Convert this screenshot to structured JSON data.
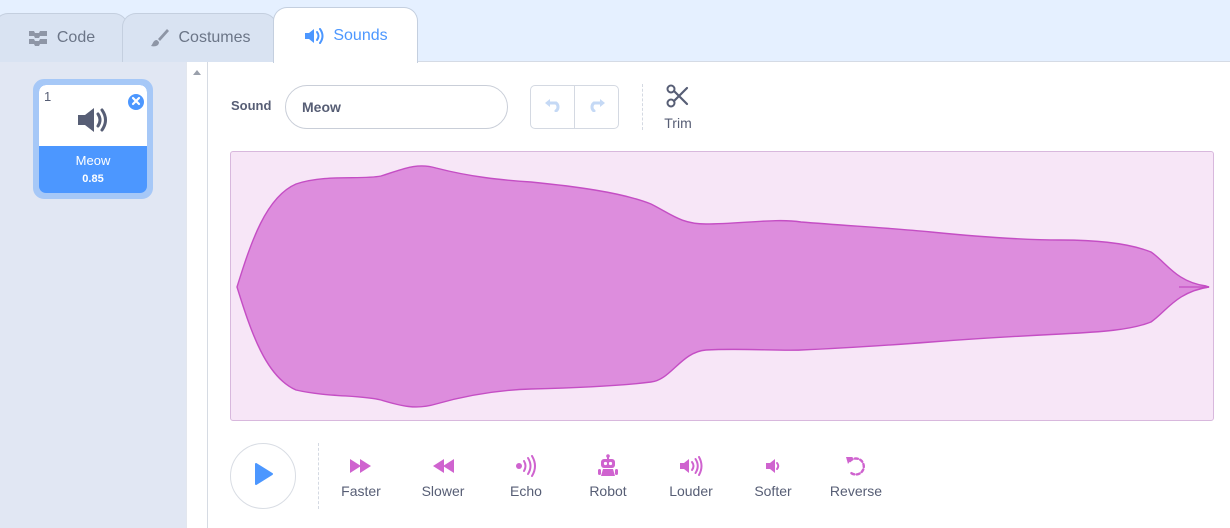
{
  "tabs": [
    {
      "label": "Code",
      "icon": "code-blocks-icon"
    },
    {
      "label": "Costumes",
      "icon": "paintbrush-icon"
    },
    {
      "label": "Sounds",
      "icon": "speaker-icon",
      "active": true
    }
  ],
  "sound_list": [
    {
      "number": "1",
      "name": "Meow",
      "duration": "0.85",
      "selected": true
    }
  ],
  "editor": {
    "sound_label": "Sound",
    "sound_name": "Meow",
    "undo_icon": "undo-icon",
    "redo_icon": "redo-icon",
    "trim_label": "Trim",
    "play_icon": "play-icon",
    "effects": [
      {
        "label": "Faster",
        "icon": "fast-forward-icon"
      },
      {
        "label": "Slower",
        "icon": "rewind-icon"
      },
      {
        "label": "Echo",
        "icon": "echo-icon"
      },
      {
        "label": "Robot",
        "icon": "robot-icon"
      },
      {
        "label": "Louder",
        "icon": "louder-icon"
      },
      {
        "label": "Softer",
        "icon": "softer-icon"
      },
      {
        "label": "Reverse",
        "icon": "reverse-icon"
      }
    ]
  },
  "colors": {
    "accent": "#4c97ff",
    "sound_magenta": "#cf63cf",
    "waveform_fill": "#dd8ddd",
    "waveform_bg": "#f7e6f7"
  }
}
